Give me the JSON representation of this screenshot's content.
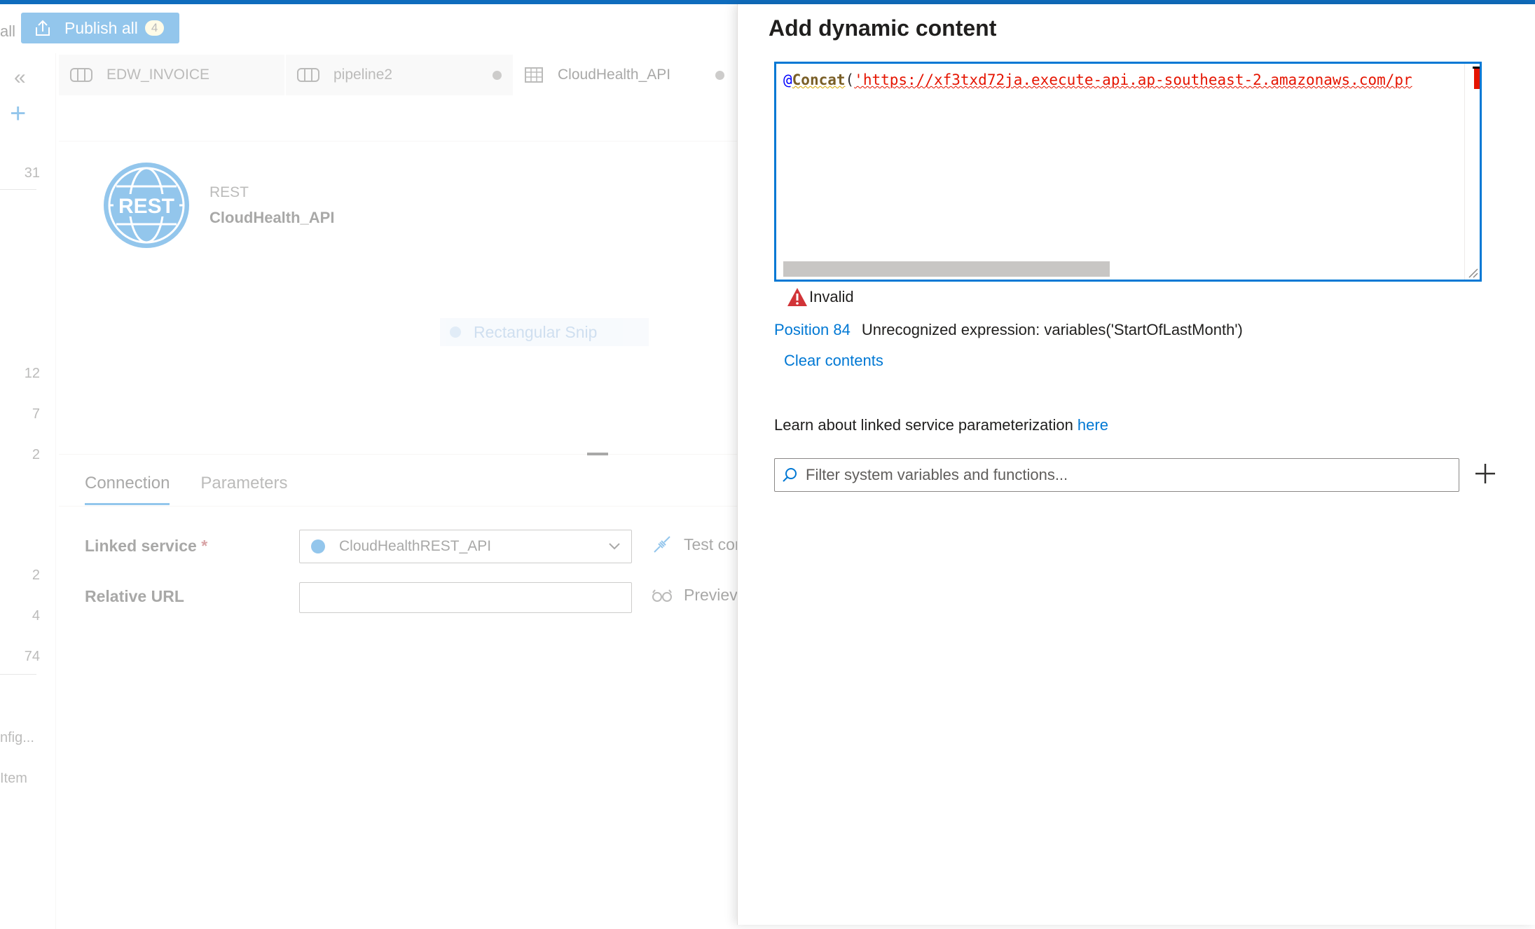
{
  "toolbar": {
    "partial_label": "all",
    "publish_label": "Publish all",
    "publish_count": "4"
  },
  "leftnav": {
    "numbers": [
      "31",
      "12",
      "7",
      "2",
      "2",
      "4",
      "74"
    ],
    "texts": [
      "nfig...",
      "Item"
    ]
  },
  "tabs": [
    {
      "label": "EDW_INVOICE",
      "icon": "pipeline-icon"
    },
    {
      "label": "pipeline2",
      "icon": "pipeline-icon"
    },
    {
      "label": "CloudHealth_API",
      "icon": "table-icon"
    }
  ],
  "dataset": {
    "logo_text": "REST",
    "type": "REST",
    "name": "CloudHealth_API",
    "snip_label": "Rectangular Snip"
  },
  "properties": {
    "tabs": [
      "Connection",
      "Parameters"
    ],
    "linked_service_label": "Linked service",
    "required_marker": "*",
    "linked_service_value": "CloudHealthREST_API",
    "relative_url_label": "Relative URL",
    "relative_url_value": "",
    "test_connection_label": "Test cor",
    "preview_label": "Previev"
  },
  "panel": {
    "title": "Add dynamic content",
    "expression": {
      "at": "@",
      "function": "Concat",
      "paren": "(",
      "string": "'https://xf3txd72ja.execute-api.ap-southeast-2.amazonaws.com/pr"
    },
    "status": "Invalid",
    "error_position": "Position 84",
    "error_message": "Unrecognized expression: variables('StartOfLastMonth')",
    "clear_label": "Clear contents",
    "learn_text": "Learn about linked service parameterization ",
    "learn_link": "here",
    "filter_placeholder": "Filter system variables and functions..."
  },
  "colors": {
    "accent": "#0078d4",
    "error": "#e51400"
  }
}
